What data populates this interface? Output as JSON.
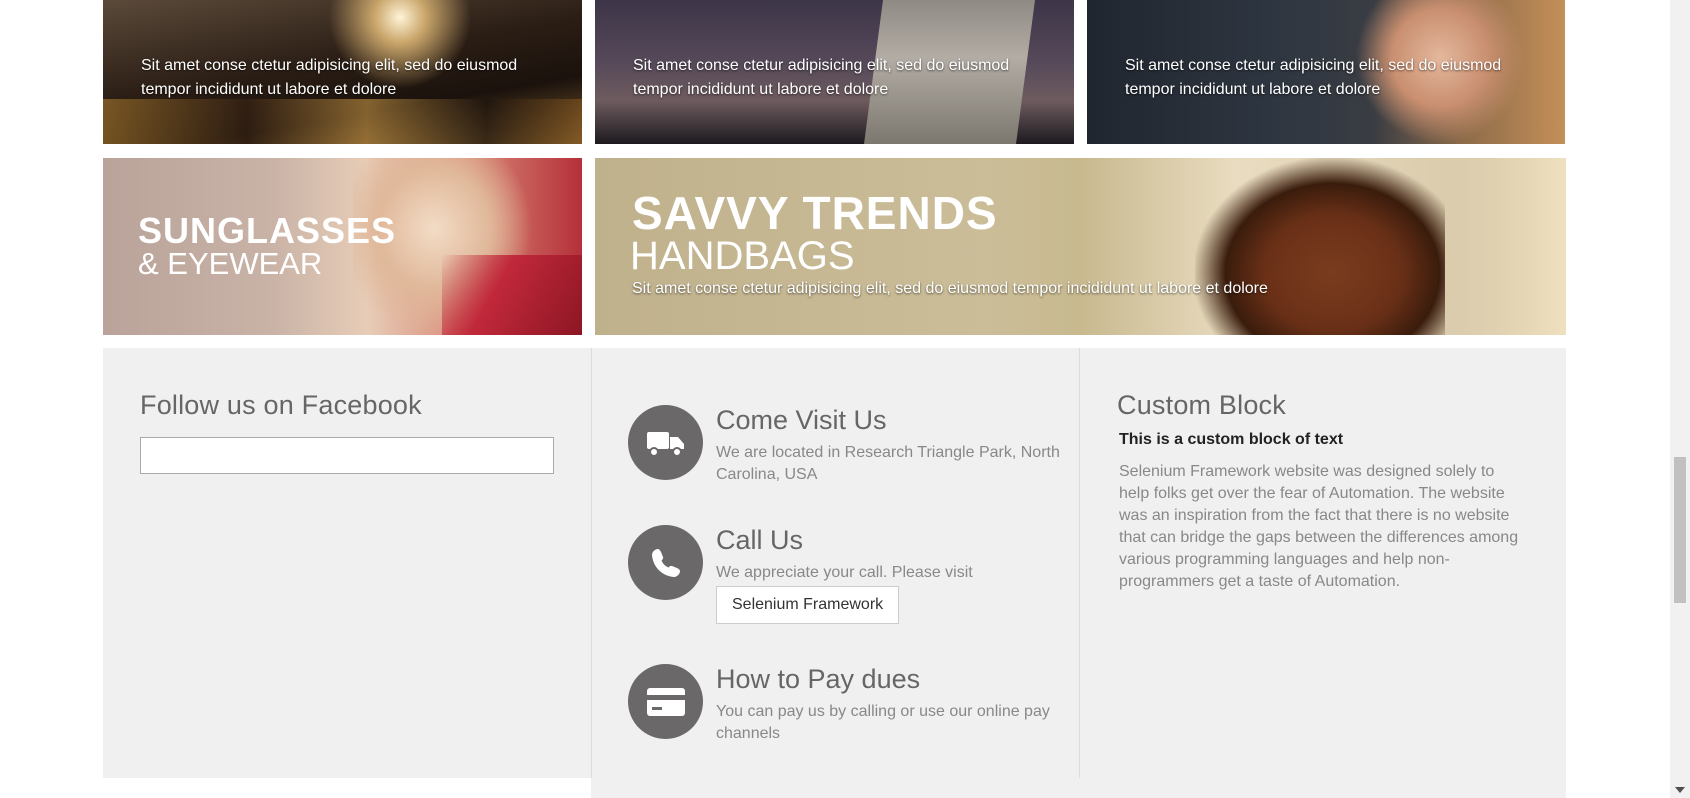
{
  "tiles": [
    {
      "caption": "Sit amet conse ctetur adipisicing elit, sed do eiusmod tempor incididunt ut labore et dolore"
    },
    {
      "caption": "Sit amet conse ctetur adipisicing elit, sed do eiusmod tempor incididunt ut labore et dolore"
    },
    {
      "caption": "Sit amet conse ctetur adipisicing elit, sed do eiusmod tempor incididunt ut labore et dolore"
    }
  ],
  "banners": {
    "sunglasses": {
      "title": "SUNGLASSES",
      "subtitle": "& EYEWEAR"
    },
    "handbags": {
      "title": "SAVVY TRENDS",
      "subtitle": "HANDBAGS",
      "caption": "Sit amet conse ctetur adipisicing elit, sed do eiusmod tempor incididunt ut labore et dolore"
    }
  },
  "footer": {
    "facebook": {
      "title": "Follow us on Facebook"
    },
    "visit": {
      "title": "Come Visit Us",
      "text": "We are located in Research Triangle Park, North Carolina, USA",
      "icon": "truck-icon"
    },
    "call": {
      "title": "Call Us",
      "text": "We appreciate your call. Please visit",
      "button_label": "Selenium Framework",
      "icon": "phone-icon"
    },
    "pay": {
      "title": "How to Pay dues",
      "text": "You can pay us by calling or use our online pay channels",
      "icon": "credit-card-icon"
    },
    "custom": {
      "title": "Custom Block",
      "subhead": "This is a custom block of text",
      "paragraph": "Selenium Framework website was designed solely to help folks get over the fear of Automation. The website was an inspiration from the fact that there is no website that can bridge the gaps between the differences among various programming languages and help non-programmers get a taste of Automation."
    }
  },
  "colors": {
    "footer_bg": "#f0f0f0",
    "icon_circle": "#6a6868",
    "title_text": "#666666",
    "body_text": "#888888"
  }
}
